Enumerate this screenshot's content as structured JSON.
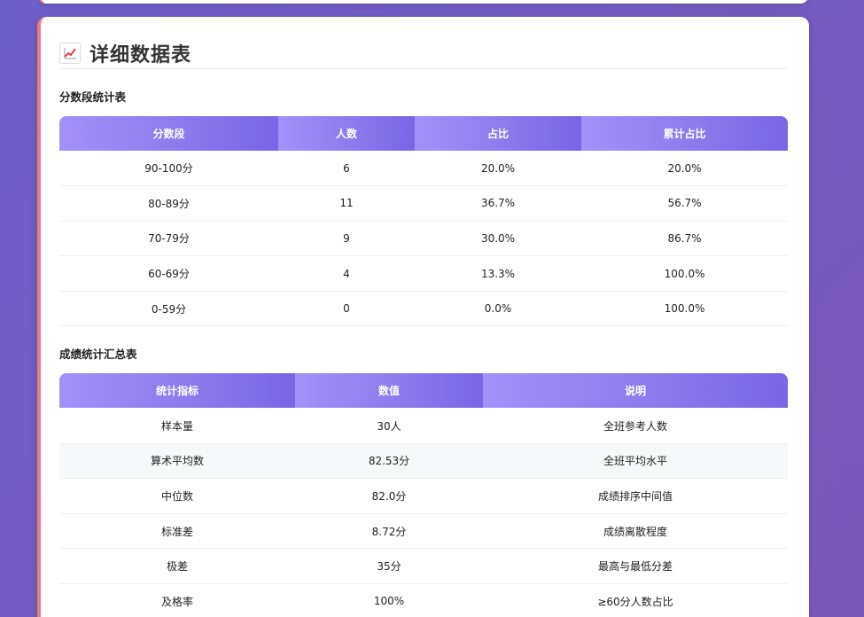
{
  "section": {
    "icon": "chart-increasing-icon",
    "title": "详细数据表"
  },
  "score_table": {
    "title": "分数段统计表",
    "headers": [
      "分数段",
      "人数",
      "占比",
      "累计占比"
    ],
    "rows": [
      [
        "90-100分",
        "6",
        "20.0%",
        "20.0%"
      ],
      [
        "80-89分",
        "11",
        "36.7%",
        "56.7%"
      ],
      [
        "70-79分",
        "9",
        "30.0%",
        "86.7%"
      ],
      [
        "60-69分",
        "4",
        "13.3%",
        "100.0%"
      ],
      [
        "0-59分",
        "0",
        "0.0%",
        "100.0%"
      ]
    ]
  },
  "summary_table": {
    "title": "成绩统计汇总表",
    "headers": [
      "统计指标",
      "数值",
      "说明"
    ],
    "rows": [
      [
        "样本量",
        "30人",
        "全班参考人数"
      ],
      [
        "算术平均数",
        "82.53分",
        "全班平均水平"
      ],
      [
        "中位数",
        "82.0分",
        "成绩排序中间值"
      ],
      [
        "标准差",
        "8.72分",
        "成绩离散程度"
      ],
      [
        "极差",
        "35分",
        "最高与最低分差"
      ],
      [
        "及格率",
        "100%",
        "≥60分人数占比"
      ]
    ]
  },
  "colors": {
    "accent_border": "#f07b7b",
    "header_gradient_start": "#a392f7",
    "header_gradient_end": "#7a66e6",
    "background": "#6f5fc9"
  }
}
